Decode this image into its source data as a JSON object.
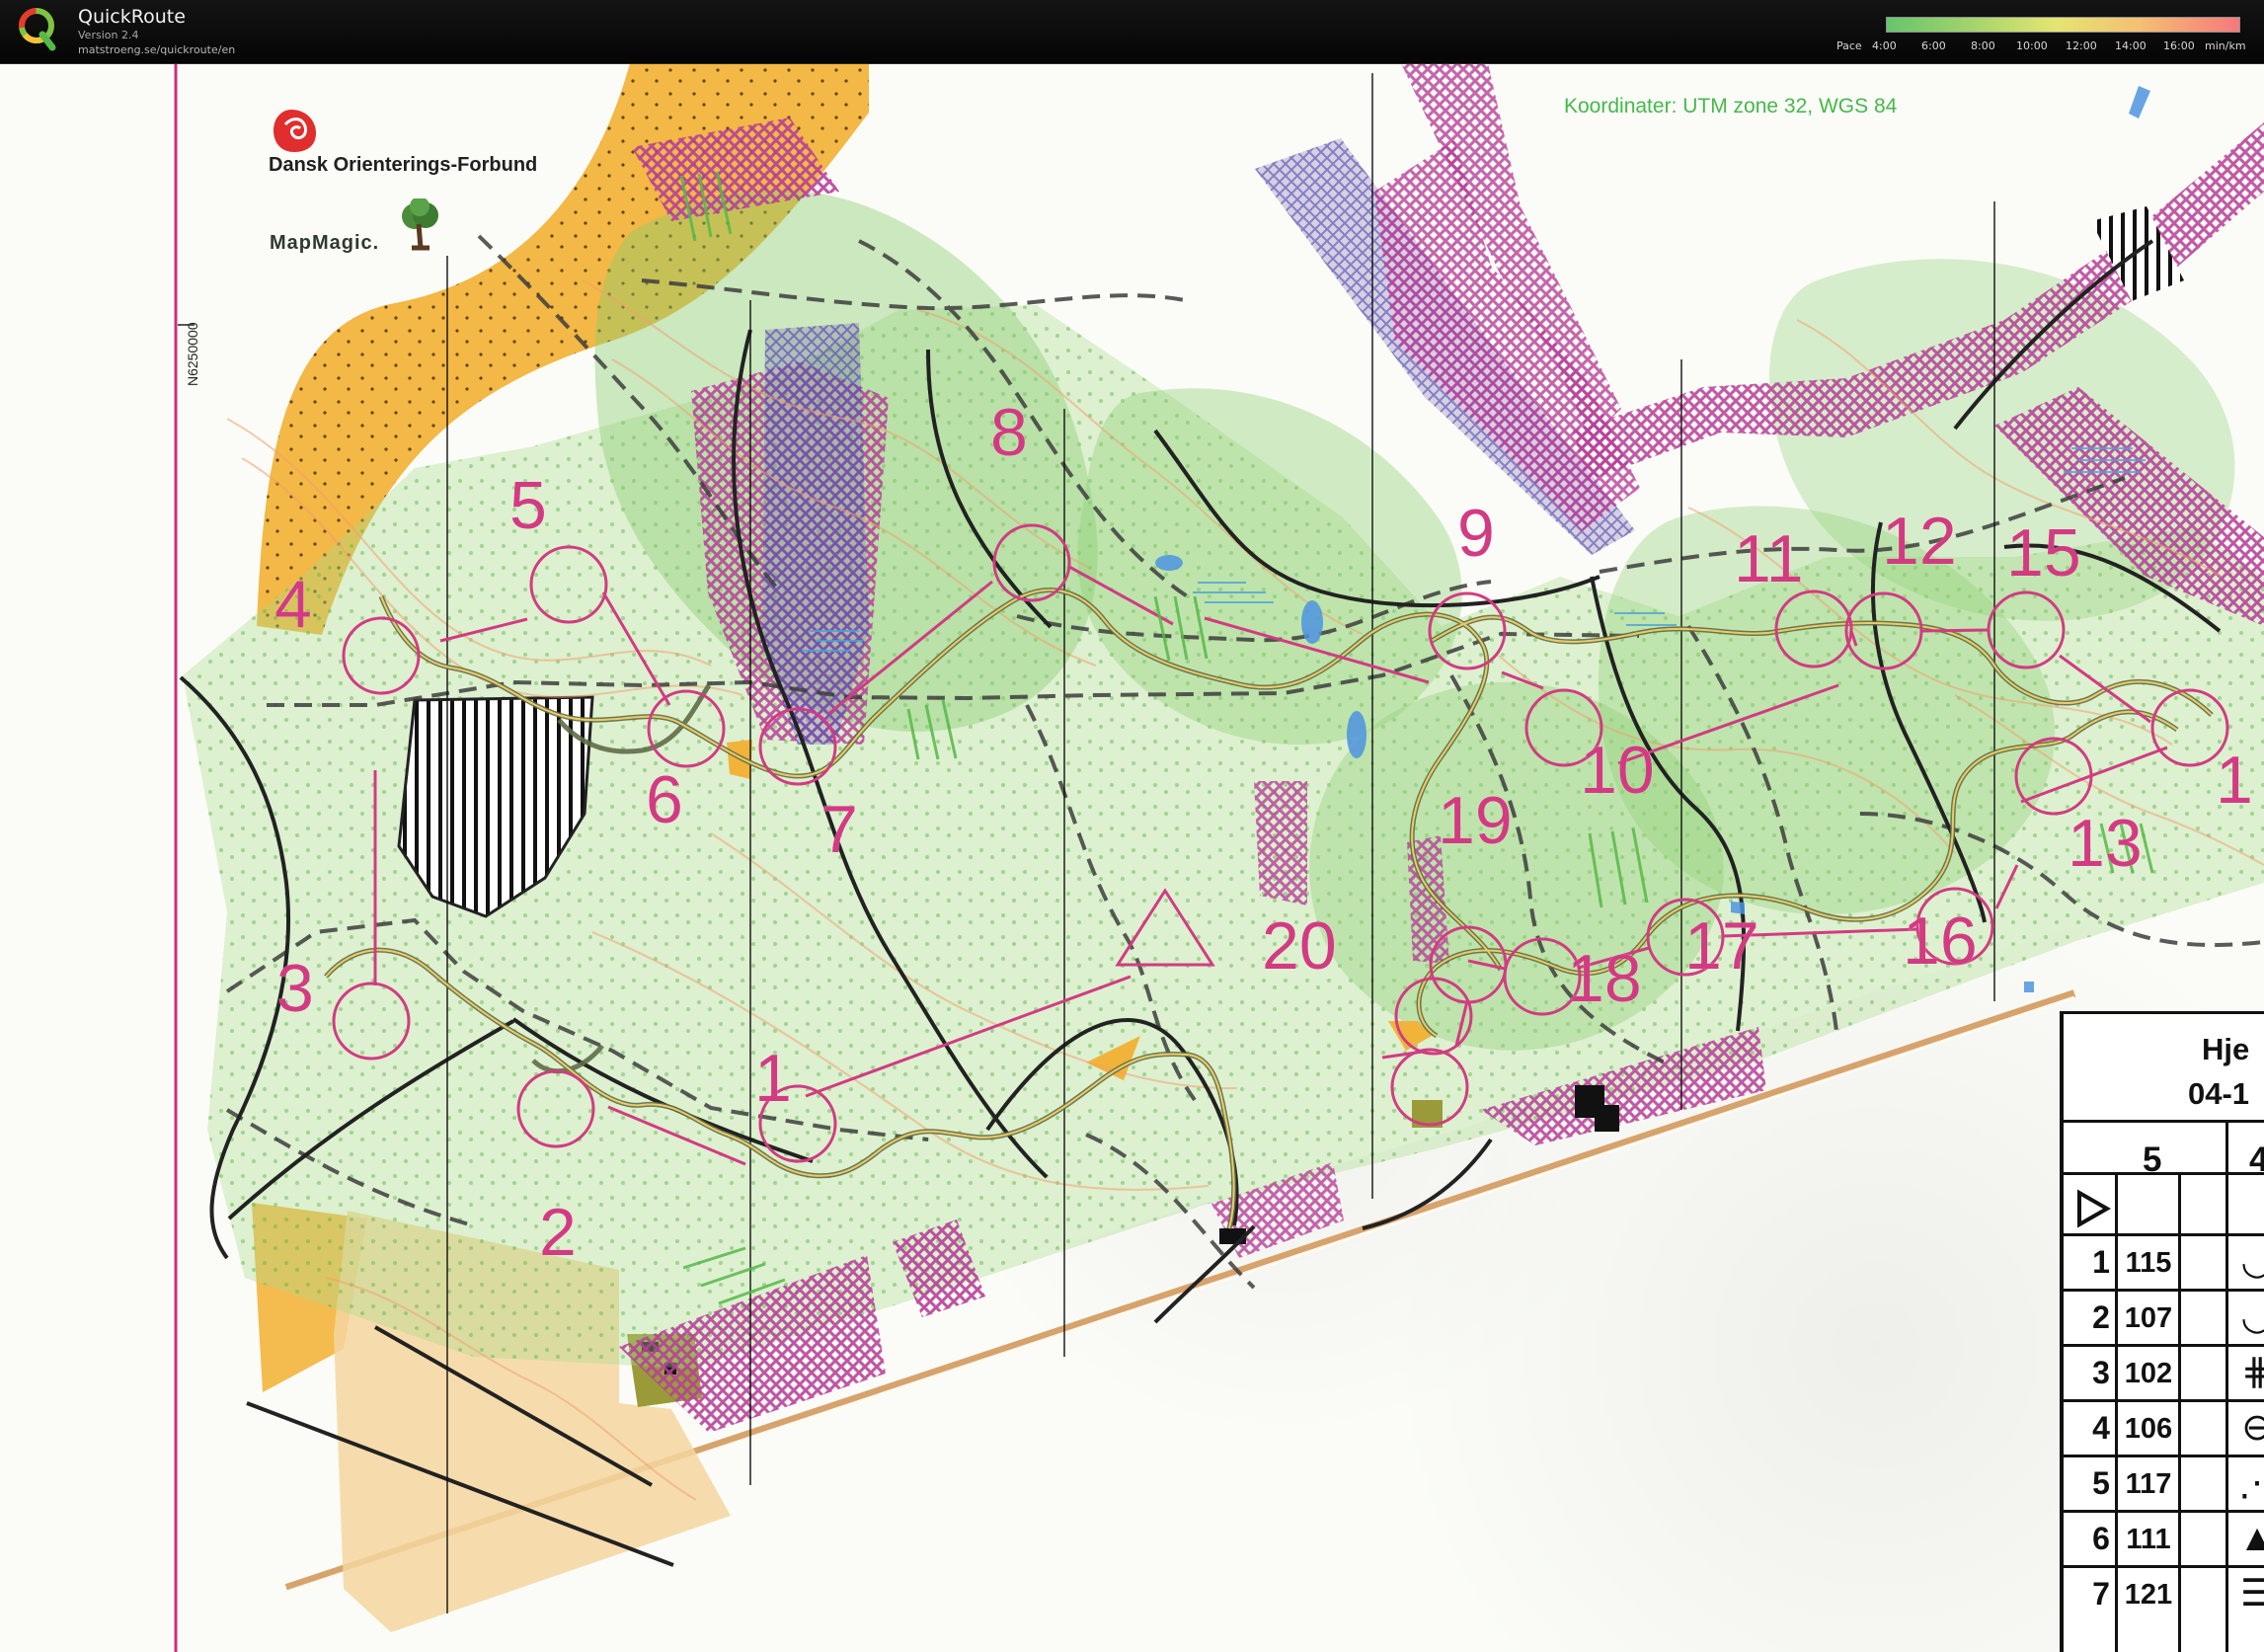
{
  "app": {
    "name": "QuickRoute",
    "version": "Version 2.4",
    "url": "matstroeng.se/quickroute/en"
  },
  "pace_legend": {
    "label": "Pace",
    "ticks": [
      "4:00",
      "6:00",
      "8:00",
      "10:00",
      "12:00",
      "14:00",
      "16:00"
    ],
    "unit": "min/km",
    "colors": [
      "#66c46d",
      "#9ed26c",
      "#e5e571",
      "#f4bf72",
      "#f6787c"
    ]
  },
  "map": {
    "organization": "Dansk Orienterings-Forbund",
    "mapper": "MapMagic.",
    "northing": "N6250000",
    "coordinate_note": "Koordinater: UTM zone 32, WGS 84",
    "controls": [
      "1",
      "2",
      "3",
      "4",
      "5",
      "6",
      "7",
      "8",
      "9",
      "10",
      "11",
      "12",
      "13",
      "15",
      "16",
      "17",
      "18",
      "19",
      "20",
      "1"
    ],
    "colors": {
      "course": "#d23b82",
      "route": "#4d5b3d",
      "forest": "#8dcc73",
      "open_land": "#f3b43c",
      "out_of_bounds": "#b73f98"
    }
  },
  "control_card": {
    "title": "Hje",
    "date": "04-1",
    "course": "5",
    "extra": "4",
    "rows": [
      {
        "num": "1",
        "code": "115",
        "symbol": "◡"
      },
      {
        "num": "2",
        "code": "107",
        "symbol": "◡"
      },
      {
        "num": "3",
        "code": "102",
        "symbol": "⋕"
      },
      {
        "num": "4",
        "code": "106",
        "symbol": "⊖"
      },
      {
        "num": "5",
        "code": "117",
        "symbol": "⋰"
      },
      {
        "num": "6",
        "code": "111",
        "symbol": "▲"
      },
      {
        "num": "7",
        "code": "121",
        "symbol": "☰"
      }
    ]
  }
}
